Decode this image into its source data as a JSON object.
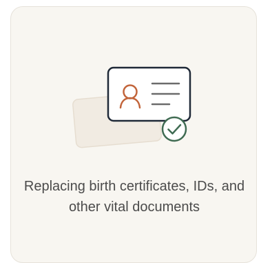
{
  "card": {
    "caption": "Replacing birth certificates, IDs, and other vital documents"
  },
  "icons": {
    "illustration": "id-card-with-checkmark-illustration",
    "person": "person-icon",
    "lines": "text-lines-icon",
    "check": "check-circle-icon"
  },
  "colors": {
    "card_background": "#f8f6f1",
    "card_border": "#e6e2da",
    "back_card": "#f1ebe2",
    "id_card_border": "#1f2937",
    "person_icon": "#c2643a",
    "text_lines": "#6b6b6b",
    "check": "#3f6b52",
    "caption_text": "#4b4b4b"
  }
}
